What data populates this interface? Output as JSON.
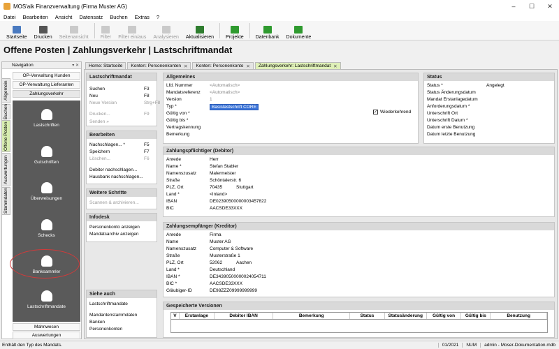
{
  "window": {
    "title": "MOS'aik Finanzverwaltung (Firma Muster AG)",
    "buttons": [
      "–",
      "☐",
      "✕"
    ]
  },
  "menu": [
    "Datei",
    "Bearbeiten",
    "Ansicht",
    "Datensatz",
    "Buchen",
    "Extras",
    "?"
  ],
  "toolbar": [
    {
      "label": "Startseite",
      "icon": "home-icon",
      "color": "#4a7ac0",
      "enabled": true
    },
    {
      "label": "Drucken",
      "icon": "print-icon",
      "color": "#555555",
      "enabled": true
    },
    {
      "label": "Seitenansicht",
      "icon": "preview-icon",
      "color": "#777777",
      "enabled": false
    },
    {
      "label": "Filter",
      "icon": "filter-icon",
      "color": "#777777",
      "enabled": false
    },
    {
      "label": "Filter ein/aus",
      "icon": "filter-toggle-icon",
      "color": "#777777",
      "enabled": false
    },
    {
      "label": "Analysieren",
      "icon": "analyze-icon",
      "color": "#777777",
      "enabled": false
    },
    {
      "label": "Aktualisieren",
      "icon": "refresh-icon",
      "color": "#2f7d2f",
      "enabled": true
    },
    {
      "label": "Projekte",
      "icon": "projects-icon",
      "color": "#2f9a2f",
      "enabled": true
    },
    {
      "label": "Datenbank",
      "icon": "database-icon",
      "color": "#2f9a2f",
      "enabled": true
    },
    {
      "label": "Dokumente",
      "icon": "documents-icon",
      "color": "#2f9a2f",
      "enabled": true
    }
  ],
  "page_title": "Offene Posten | Zahlungsverkehr | Lastschriftmandat",
  "navigation": {
    "header": "Navigation",
    "pins": "▾ ✕",
    "vertical_tabs": [
      "Allgemein",
      "Buchen",
      "Offene Posten",
      "Auswertungen",
      "Stammdaten"
    ],
    "links_top": [
      "OP-Verwaltung Kunden",
      "OP-Verwaltung Lieferanten",
      "Zahlungsverkehr"
    ],
    "items": [
      "Lastschriften",
      "Gutschriften",
      "Überweisungen",
      "Schecks",
      "Banksammler",
      "Lastschriftmandate"
    ],
    "links_bottom": [
      "Mahnwesen",
      "Auswertungen"
    ]
  },
  "tabs": [
    {
      "label": "Home: Startseite",
      "active": false
    },
    {
      "label": "Konten: Personenkonten",
      "active": false,
      "close": "✕"
    },
    {
      "label": "Konten: Personenkonto",
      "active": false,
      "close": "✕"
    },
    {
      "label": "Zahlungsverkehr: Lastschriftmandat",
      "active": true,
      "close": "✕"
    }
  ],
  "actions": {
    "lastschriftmandat": {
      "title": "Lastschriftmandat",
      "items": [
        {
          "label": "Suchen",
          "key": "F3",
          "enabled": true
        },
        {
          "label": "Neu",
          "key": "F8",
          "enabled": true
        },
        {
          "label": "Neue Version",
          "key": "Strg+F8",
          "enabled": false
        },
        {
          "label": "Drucken...",
          "key": "F9",
          "enabled": false
        },
        {
          "label": "Senden »",
          "key": "",
          "enabled": false
        }
      ]
    },
    "bearbeiten": {
      "title": "Bearbeiten",
      "items": [
        {
          "label": "Nachschlagen... *",
          "key": "F5",
          "enabled": true
        },
        {
          "label": "Speichern",
          "key": "F7",
          "enabled": true
        },
        {
          "label": "Löschen...",
          "key": "F6",
          "enabled": false
        },
        {
          "label": "Debitor nachschlagen...",
          "key": "",
          "enabled": true
        },
        {
          "label": "Hausbank nachschlagen...",
          "key": "",
          "enabled": true
        }
      ]
    },
    "weitere": {
      "title": "Weitere Schritte",
      "items": [
        {
          "label": "Scannen & archivieren...",
          "key": "",
          "enabled": false
        }
      ]
    },
    "infodesk": {
      "title": "Infodesk",
      "items": [
        {
          "label": "Personenkonto anzeigen"
        },
        {
          "label": "Mandatsarchiv anzeigen"
        }
      ]
    },
    "sieheauch": {
      "title": "Siehe auch",
      "items": [
        {
          "label": "Lastschriftmandate"
        },
        {
          "label": "Mandantenstammdaten"
        },
        {
          "label": "Banken"
        },
        {
          "label": "Personenkonten"
        }
      ]
    }
  },
  "allgemeines": {
    "title": "Allgemeines",
    "rows": [
      {
        "label": "Lfd. Nummer",
        "value": "<Automatisch>",
        "style": "placeholder"
      },
      {
        "label": "Mandatsreferenz",
        "value": "<Automatisch>",
        "style": "placeholder"
      },
      {
        "label": "Version",
        "value": "1",
        "style": "placeholder"
      },
      {
        "label": "Typ *",
        "value": "Basislastschrift CORE",
        "style": "selected"
      },
      {
        "label": "Gültig von *",
        "value": "",
        "style": ""
      },
      {
        "label": "Gültig bis *",
        "value": "",
        "style": ""
      },
      {
        "label": "Vertragskennung",
        "value": "",
        "style": ""
      },
      {
        "label": "Bemerkung",
        "value": "",
        "style": ""
      }
    ],
    "checkbox_label": "Wiederkehrend",
    "checkbox_mark": "✓"
  },
  "status": {
    "title": "Status",
    "rows": [
      {
        "label": "Status *",
        "value": "Angelegt"
      },
      {
        "label": "Status Änderungsdatum",
        "value": ""
      },
      {
        "label": "Mandat Erstanlagedatum",
        "value": ""
      },
      {
        "label": "Anforderungsdatum *",
        "value": ""
      },
      {
        "label": "Unterschrift Ort",
        "value": ""
      },
      {
        "label": "Unterschrift Datum *",
        "value": ""
      },
      {
        "label": "Datum erste Benutzung",
        "value": ""
      },
      {
        "label": "Datum letzte Benutzung",
        "value": ""
      }
    ]
  },
  "debitor": {
    "title": "Zahlungspflichtiger (Debitor)",
    "rows": [
      {
        "label": "Anrede",
        "value": "Herr",
        "value2": ""
      },
      {
        "label": "Name *",
        "value": "Stefan Stabler",
        "value2": ""
      },
      {
        "label": "Namenszusatz",
        "value": "Malermeister",
        "value2": ""
      },
      {
        "label": "Straße",
        "value": "Schöntalerstr. 6",
        "value2": ""
      },
      {
        "label": "PLZ, Ort",
        "value": "70435",
        "value2": "Stuttgart"
      },
      {
        "label": "Land *",
        "value": "<Inland>",
        "value2": ""
      },
      {
        "label": "IBAN",
        "value": "DE02390500000003457822",
        "value2": ""
      },
      {
        "label": "BIC",
        "value": "AACSDE33XXX",
        "value2": ""
      }
    ]
  },
  "kreditor": {
    "title": "Zahlungsempfänger (Kreditor)",
    "rows": [
      {
        "label": "Anrede",
        "value": "Firma",
        "value2": ""
      },
      {
        "label": "Name",
        "value": "Muster AG",
        "value2": ""
      },
      {
        "label": "Namenszusatz",
        "value": "Computer & Software",
        "value2": ""
      },
      {
        "label": "Straße",
        "value": "Musterstraße 1",
        "value2": ""
      },
      {
        "label": "PLZ, Ort",
        "value": "52062",
        "value2": "Aachen"
      },
      {
        "label": "Land *",
        "value": "Deutschland",
        "value2": ""
      },
      {
        "label": "IBAN *",
        "value": "DE34390500000024054711",
        "value2": ""
      },
      {
        "label": "BIC *",
        "value": "AACSDE33XXX",
        "value2": ""
      },
      {
        "label": "Gläubiger-ID",
        "value": "DE98ZZZ09999999999",
        "value2": ""
      }
    ]
  },
  "versionen": {
    "title": "Gespeicherte Versionen",
    "columns": [
      "V",
      "Erstanlage",
      "Debitor IBAN",
      "Bemerkung",
      "Status",
      "Statusänderung",
      "Gültig von",
      "Gültig bis",
      "Benutzung"
    ]
  },
  "statusbar": {
    "text": "Enthält den Typ des Mandats.",
    "period": "01/2021",
    "numlock": "NUM",
    "user": "admin - Moser-Dokumentation.mdb"
  }
}
